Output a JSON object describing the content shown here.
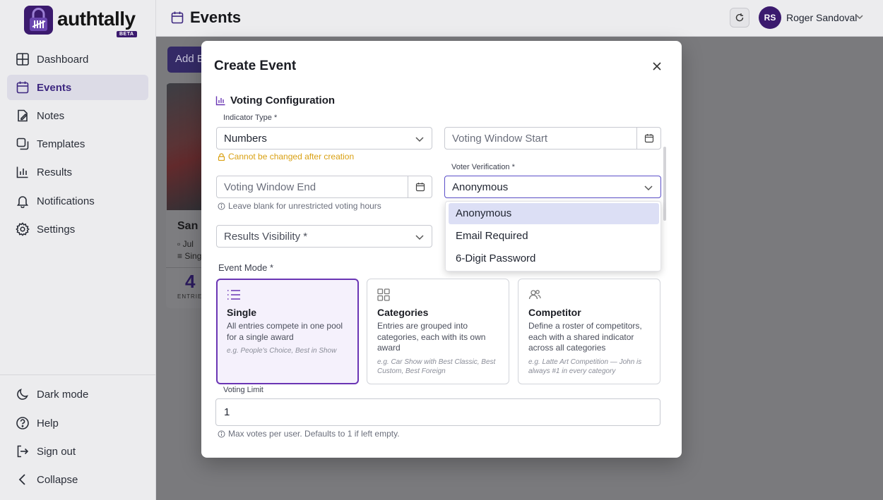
{
  "brand": {
    "name": "authtally",
    "badge": "BETA",
    "color": "#3b1a6e"
  },
  "sidebar": {
    "items": [
      {
        "label": "Dashboard",
        "icon": "dashboard-icon"
      },
      {
        "label": "Events",
        "icon": "calendar-icon",
        "active": true
      },
      {
        "label": "Notes",
        "icon": "notes-icon"
      },
      {
        "label": "Templates",
        "icon": "templates-icon"
      },
      {
        "label": "Results",
        "icon": "results-icon"
      },
      {
        "label": "Notifications",
        "icon": "bell-icon"
      },
      {
        "label": "Settings",
        "icon": "gear-icon"
      }
    ],
    "bottom": [
      {
        "label": "Dark mode",
        "icon": "moon-icon"
      },
      {
        "label": "Help",
        "icon": "help-icon"
      },
      {
        "label": "Sign out",
        "icon": "sign-out-icon"
      },
      {
        "label": "Collapse",
        "icon": "chevron-left-icon"
      }
    ]
  },
  "header": {
    "title": "Events",
    "user": {
      "initials": "RS",
      "name": "Roger Sandoval"
    }
  },
  "background": {
    "add_button": "Add E",
    "card": {
      "title": "San",
      "meta_date": "Jul",
      "meta_mode": "Sing",
      "count": "4",
      "count_label": "ENTRIES"
    }
  },
  "modal": {
    "title": "Create Event",
    "section_title": "Voting Configuration",
    "indicator_type": {
      "label": "Indicator Type *",
      "value": "Numbers",
      "warning": "Cannot be changed after creation"
    },
    "voting_window_start": {
      "placeholder": "Voting Window Start"
    },
    "voting_window_end": {
      "placeholder": "Voting Window End",
      "hint": "Leave blank for unrestricted voting hours"
    },
    "voter_verification": {
      "label": "Voter Verification *",
      "value": "Anonymous",
      "options": [
        "Anonymous",
        "Email Required",
        "6-Digit Password"
      ],
      "selected_index": 0
    },
    "results_visibility": {
      "placeholder": "Results Visibility *"
    },
    "event_mode": {
      "label": "Event Mode *",
      "selected": "Single",
      "options": [
        {
          "title": "Single",
          "icon": "list-icon",
          "description": "All entries compete in one pool for a single award",
          "example": "e.g. People's Choice, Best in Show"
        },
        {
          "title": "Categories",
          "icon": "grid-icon",
          "description": "Entries are grouped into categories, each with its own award",
          "example": "e.g. Car Show with Best Classic, Best Custom, Best Foreign"
        },
        {
          "title": "Competitor",
          "icon": "users-icon",
          "description": "Define a roster of competitors, each with a shared indicator across all categories",
          "example": "e.g. Latte Art Competition — John is always #1 in every category"
        }
      ]
    },
    "voting_limit": {
      "label": "Voting Limit",
      "value": "1",
      "hint": "Max votes per user. Defaults to 1 if left empty."
    }
  },
  "colors": {
    "accent": "#6a35b4",
    "brand": "#3b1a6e",
    "warning": "#d9a012",
    "overlay": "#7a7a7d"
  }
}
